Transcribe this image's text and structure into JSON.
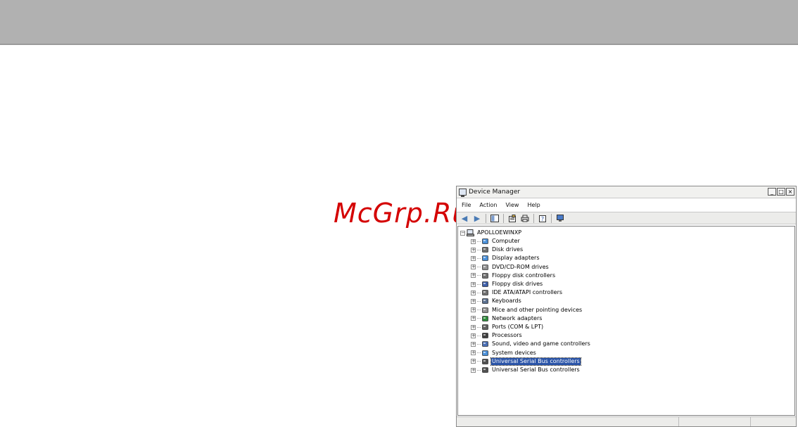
{
  "watermark": {
    "text": "McGrp.Ru"
  },
  "window": {
    "title": "Device Manager",
    "controls": {
      "minimize": "_",
      "maximize": "□",
      "close": "×"
    },
    "menu": [
      "File",
      "Action",
      "View",
      "Help"
    ],
    "toolbar_icons": [
      "back-icon",
      "forward-icon",
      "show-hide-tree-icon",
      "properties-icon",
      "print-icon",
      "help-icon",
      "monitor-icon"
    ]
  },
  "tree": {
    "root": "APOLLOEWINXP",
    "items": [
      {
        "label": "Computer",
        "icon": "computer-icon",
        "color": "#4a90d9"
      },
      {
        "label": "Disk drives",
        "icon": "disk-drive-icon",
        "color": "#707070"
      },
      {
        "label": "Display adapters",
        "icon": "display-adapter-icon",
        "color": "#4a90d9"
      },
      {
        "label": "DVD/CD-ROM drives",
        "icon": "cdrom-icon",
        "color": "#909090"
      },
      {
        "label": "Floppy disk controllers",
        "icon": "floppy-controller-icon",
        "color": "#707070"
      },
      {
        "label": "Floppy disk drives",
        "icon": "floppy-drive-icon",
        "color": "#3d5ea8"
      },
      {
        "label": "IDE ATA/ATAPI controllers",
        "icon": "ide-controller-icon",
        "color": "#707070"
      },
      {
        "label": "Keyboards",
        "icon": "keyboard-icon",
        "color": "#5a6f8f"
      },
      {
        "label": "Mice and other pointing devices",
        "icon": "mouse-icon",
        "color": "#909090"
      },
      {
        "label": "Network adapters",
        "icon": "network-adapter-icon",
        "color": "#2e8b3a"
      },
      {
        "label": "Ports (COM & LPT)",
        "icon": "port-icon",
        "color": "#606060"
      },
      {
        "label": "Processors",
        "icon": "processor-icon",
        "color": "#404040"
      },
      {
        "label": "Sound, video and game controllers",
        "icon": "sound-icon",
        "color": "#4a6fb5"
      },
      {
        "label": "System devices",
        "icon": "system-device-icon",
        "color": "#4a90d9"
      },
      {
        "label": "Universal Serial Bus controllers",
        "icon": "usb-icon",
        "color": "#505050",
        "selected": true
      },
      {
        "label": "Universal Serial Bus controllers",
        "icon": "usb-icon",
        "color": "#505050",
        "selected": false
      }
    ]
  },
  "colors": {
    "selection": "#2a54a8",
    "top_band": "#b1b1b1",
    "watermark": "#d40000"
  }
}
